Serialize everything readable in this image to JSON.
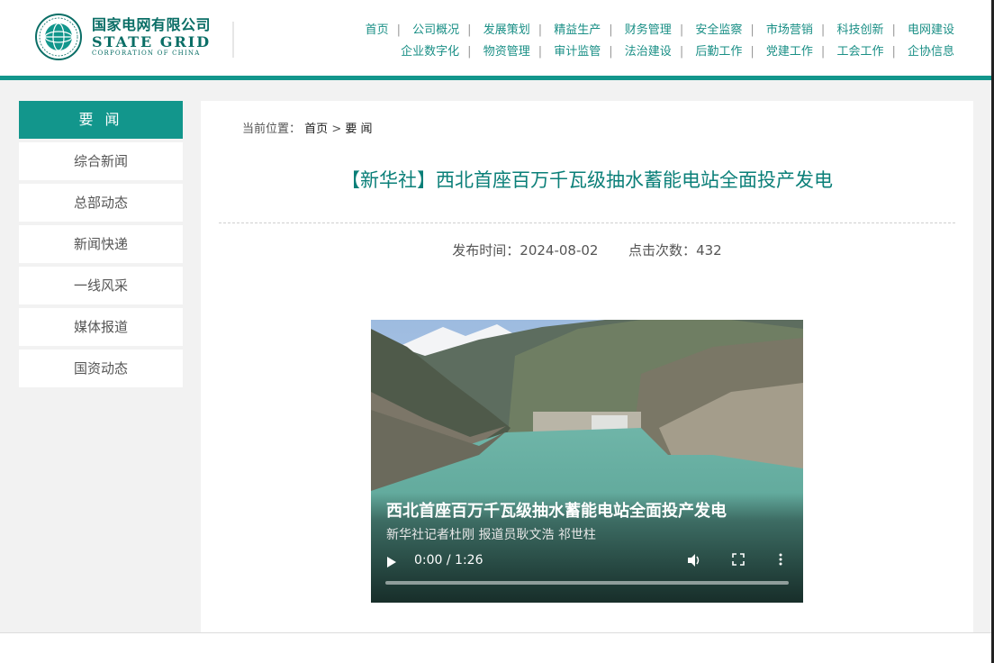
{
  "logo": {
    "cn": "国家电网有限公司",
    "en": "STATE GRID",
    "en_small": "CORPORATION OF CHINA"
  },
  "nav": {
    "row1": [
      "首页",
      "公司概况",
      "发展策划",
      "精益生产",
      "财务管理",
      "安全监察",
      "市场营销",
      "科技创新",
      "电网建设"
    ],
    "row2": [
      "企业数字化",
      "物资管理",
      "审计监管",
      "法治建设",
      "后勤工作",
      "党建工作",
      "工会工作",
      "企协信息"
    ]
  },
  "sidebar": {
    "heading": "要 闻",
    "items": [
      "综合新闻",
      "总部动态",
      "新闻快递",
      "一线风采",
      "媒体报道",
      "国资动态"
    ]
  },
  "breadcrumb": {
    "prefix": "当前位置：",
    "home": "首页",
    "sep": ">",
    "current": "要 闻"
  },
  "article": {
    "title": "【新华社】西北首座百万千瓦级抽水蓄能电站全面投产发电",
    "publish_label": "发布时间：",
    "publish_date": "2024-08-02",
    "clicks_label": "点击次数：",
    "clicks": "432"
  },
  "video": {
    "title": "西北首座百万千瓦级抽水蓄能电站全面投产发电",
    "subtitle": "新华社记者杜刚  报道员耿文浩 祁世柱",
    "time": "0:00 / 1:26",
    "progress": 0,
    "icons": [
      "play-icon",
      "volume-icon",
      "fullscreen-icon",
      "more-options-icon"
    ]
  },
  "colors": {
    "brand": "#12968c",
    "title": "#0a7f78",
    "nav_link": "#1a8f86"
  }
}
